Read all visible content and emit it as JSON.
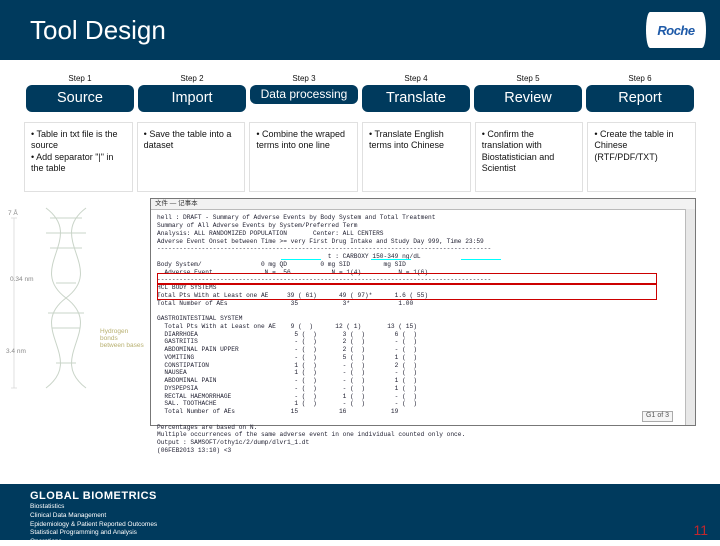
{
  "title": "Tool Design",
  "logo_text": "Roche",
  "steps": [
    {
      "label": "Step 1",
      "title": "Source",
      "desc": [
        "Table in txt file is the source",
        "Add separator \"|\" in the table"
      ]
    },
    {
      "label": "Step 2",
      "title": "Import",
      "desc": [
        "Save the table into a dataset"
      ]
    },
    {
      "label": "Step 3",
      "title": "Data processing",
      "desc": [
        "Combine the wraped terms into one line"
      ]
    },
    {
      "label": "Step 4",
      "title": "Translate",
      "desc": [
        "Translate English terms into Chinese"
      ]
    },
    {
      "label": "Step 5",
      "title": "Review",
      "desc": [
        "Confirm the translation with Biostatistician and Scientist"
      ]
    },
    {
      "label": "Step 6",
      "title": "Report",
      "desc": [
        "Create the table in Chinese (RTF/PDF/TXT)"
      ]
    }
  ],
  "screenshot": {
    "window_hint": "文件 — 记事本",
    "header": [
      "hell : DRAFT - Summary of Adverse Events by Body System and Total Treatment",
      "Summary of All Adverse Events by System/Preferred Term",
      "Analysis: ALL RANDOMIZED POPULATION       Center: ALL CENTERS",
      "Adverse Event Onset between Time >= very First Drug Intake and Study Day 999, Time 23:59"
    ],
    "col_header_top": "                                              t : CARBOXY 150-349 ng/dL",
    "col_header": "Body System/                0 mg QD         0 mg SID         mg SID",
    "col_header2": "  Adverse Event              N =  56           N = 1(4)          N = 1(6)",
    "section_label": "HCL BODY SYSTEMS",
    "rows_top": [
      "Total Pts With at Least one AE     39 ( 61)      49 ( 97)*      1.6 ( 55)",
      "Total Number of AEs                 35            3*             1.00"
    ],
    "group_label": "GASTROINTESTINAL SYSTEM",
    "rows": [
      "  Total Pts With at Least one AE    9 (  )      12 ( 1)       13 ( 15)",
      "  DIARRHOEA                          5 (  )       3 (  )        6 (  )",
      "  GASTRITIS                          - (  )       2 (  )        - (  )",
      "  ABDOMINAL PAIN UPPER               - (  )       2 (  )        - (  )",
      "  VOMITING                           - (  )       5 (  )        1 (  )",
      "  CONSTIPATION                       1 (  )       - (  )        2 (  )",
      "  NAUSEA                             1 (  )       - (  )        - (  )",
      "  ABDOMINAL PAIN                     - (  )       - (  )        1 (  )",
      "  DYSPEPSIA                          - (  )       - (  )        1 (  )",
      "  RECTAL HAEMORRHAGE                 - (  )       1 (  )        - (  )",
      "  SAL. TOOTHACHE                     1 (  )       - (  )        - (  )",
      "  Total Number of AEs               15           16            19"
    ],
    "footnote1": "Percentages are based on N.",
    "footnote2": "Multiple occurrences of the same adverse event in one individual counted only once.",
    "source": "Output : SAMSOFT/othy1c/2/dump/dlvr1_1.dt",
    "date": "(06FEB2013 13:10) <3",
    "page": "G1 of 3"
  },
  "dna_labels": {
    "top": "7 Å",
    "mid": "0.34 nm",
    "bottom": "3.4 nm",
    "right": "Hydrogen bonds between bases"
  },
  "footer": {
    "heading": "GLOBAL BIOMETRICS",
    "lines": [
      "Biostatistics",
      "  Clinical Data Management",
      "  Epidemiology & Patient Reported Outcomes",
      "    Statistical Programming and Analysis",
      "      Operations"
    ]
  },
  "page_number": "11"
}
